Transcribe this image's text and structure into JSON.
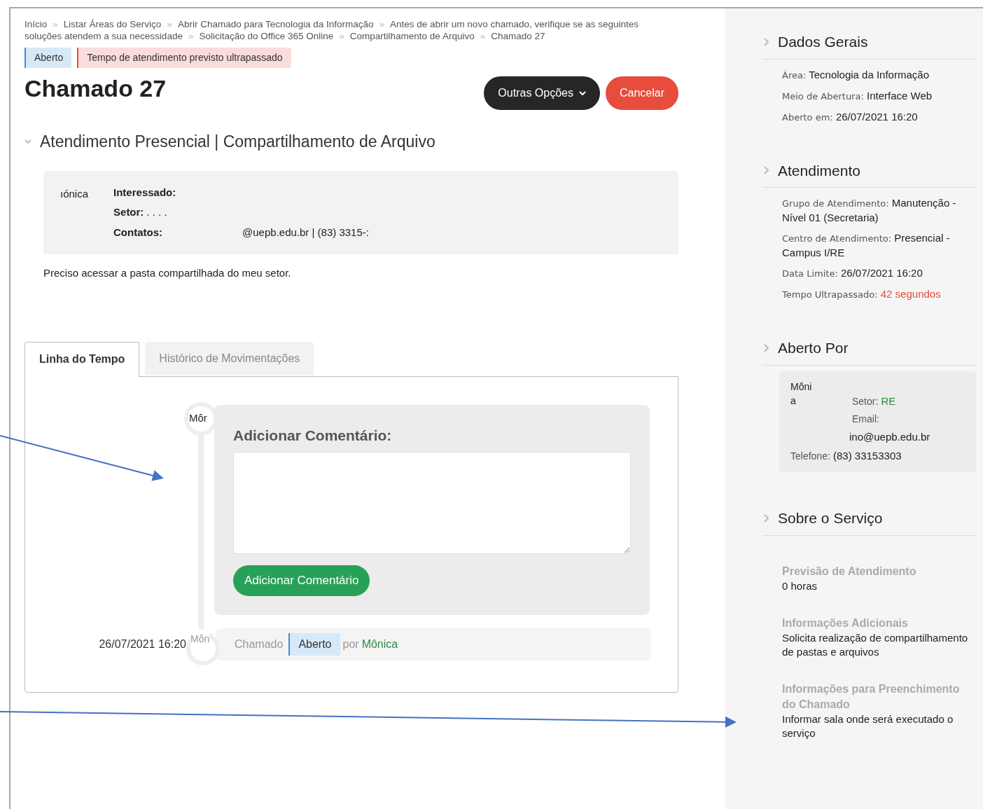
{
  "breadcrumb_separator": "»",
  "breadcrumb": [
    "Início",
    "Listar Áreas do Serviço",
    "Abrir Chamado para Tecnologia da Informação",
    "Antes de abrir um novo chamado, verifique se as seguintes soluções atendem a sua necessidade",
    "Solicitação do Office 365 Online",
    "Compartilhamento de Arquivo",
    "Chamado 27"
  ],
  "badges": [
    {
      "label": "Aberto",
      "kind": "info"
    },
    {
      "label": "Tempo de atendimento previsto ultrapassado",
      "kind": "danger"
    }
  ],
  "title": "Chamado 27",
  "actions": [
    {
      "label": "Outras Opções",
      "kind": "dropdown"
    },
    {
      "label": "Cancelar",
      "kind": "danger"
    }
  ],
  "service": {
    "title": "Atendimento Presencial | Compartilhamento de Arquivo",
    "expanded": true
  },
  "requester": {
    "name": "ıónica",
    "fields": [
      {
        "label": "Interessado:"
      },
      {
        "label": "Setor:",
        "value": ". . . ."
      },
      {
        "label": "Contatos:",
        "value": "@uepb.edu.br | (83) 3315-:"
      }
    ]
  },
  "description": "Preciso acessar a pasta compartilhada do meu setor.",
  "tabs": [
    {
      "label": "Linha do Tempo",
      "selected": true
    },
    {
      "label": "Histórico de Movimentações",
      "selected": false
    }
  ],
  "timeline": {
    "avatar_label": "Môr",
    "comment_title": "Adicionar Comentário:",
    "comment_button": "Adicionar Comentário",
    "events": [
      {
        "time": "26/07/2021 16:20",
        "avatar_label": "Môn",
        "text": "Chamado",
        "status": "Aberto",
        "by": "por",
        "user": "Mônica"
      }
    ]
  },
  "sidebar": [
    {
      "title": "Dados Gerais",
      "kind": "fields",
      "fields": [
        {
          "label": "Área:",
          "value": "Tecnologia da Informação"
        },
        {
          "label": "Meio de Abertura:",
          "value": "Interface Web"
        },
        {
          "label": "Aberto em:",
          "value": "26/07/2021 16:20"
        }
      ]
    },
    {
      "title": "Atendimento",
      "kind": "fields",
      "fields": [
        {
          "label": "Grupo de Atendimento:",
          "value": "Manutenção - Nível 01 (Secretaria)"
        },
        {
          "label": "Centro de Atendimento:",
          "value": "Presencial - Campus I/RE"
        },
        {
          "label": "Data Limite:",
          "value": "26/07/2021 16:20"
        },
        {
          "label": "Tempo Ultrapassado:",
          "value": "42 segundos",
          "alert": true
        }
      ]
    },
    {
      "title": "Aberto Por",
      "kind": "person",
      "name": "Môni a",
      "setor_label": "Setor:",
      "setor": "RE",
      "email_label": "Email:",
      "email": "ino@uepb.edu.br",
      "phone_label": "Telefone:",
      "phone": "(83) 33153303"
    },
    {
      "title": "Sobre o Serviço",
      "kind": "info",
      "items": [
        {
          "heading": "Previsão de Atendimento",
          "text": "0 horas"
        },
        {
          "heading": "Informações Adicionais",
          "text": "Solicita realização de compartilhamento de pastas e arquivos"
        },
        {
          "heading": "Informações para Preenchimento do Chamado",
          "text": "Informar sala onde será executado o serviço"
        }
      ]
    }
  ]
}
